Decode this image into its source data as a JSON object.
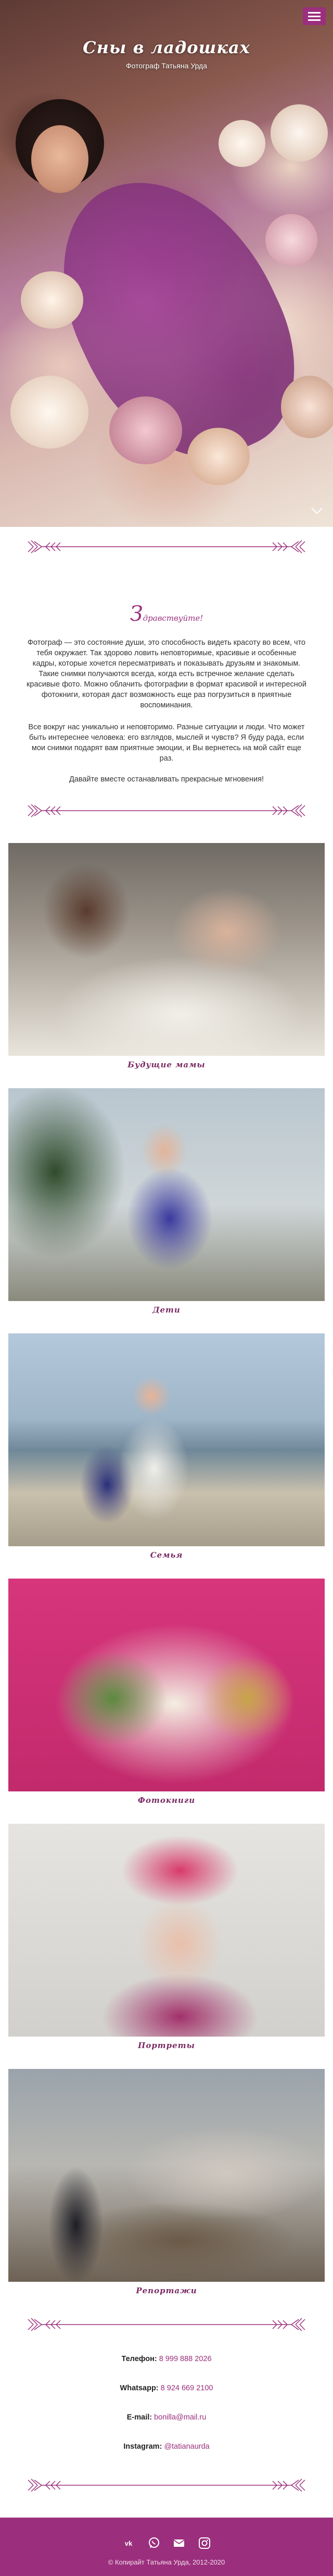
{
  "header": {
    "title": "Сны в ладошках",
    "subtitle": "Фотограф Татьяна Урда",
    "menu_icon": "hamburger-icon",
    "scroll_icon": "chevron-down-icon"
  },
  "intro": {
    "greeting_initial": "З",
    "greeting_rest": "дравствуйте!",
    "paragraph1": "Фотограф — это состояние души, это способность видеть красоту во всем, что тебя окружает. Так здорово ловить неповторимые, красивые и особенные кадры, которые хочется пересматривать и показывать друзьям и знакомым. Такие снимки получаются всегда, когда есть встречное желание сделать красивые фото. Можно облачить фотографии в формат красивой и интересной фотокниги, которая даст возможность еще раз погрузиться в приятные воспоминания.",
    "paragraph2": "Все вокруг нас уникально и неповторимо. Разные ситуации и люди. Что может быть интереснее человека: его взглядов, мыслей и чувств? Я буду рада, если мои снимки подарят вам приятные эмоции, и Вы вернетесь на мой сайт еще раз.",
    "paragraph3": "Давайте вместе останавливать прекрасные мгновения!"
  },
  "gallery": [
    {
      "caption": "Будущие мамы"
    },
    {
      "caption": "Дети"
    },
    {
      "caption": "Семья"
    },
    {
      "caption": "Фотокниги"
    },
    {
      "caption": "Портреты"
    },
    {
      "caption": "Репортажи"
    }
  ],
  "contacts": {
    "phone_label": "Телефон:",
    "phone_value": "8 999 888 2026",
    "whatsapp_label": "Whatsapp:",
    "whatsapp_value": "8 924 669 2100",
    "email_label": "E-mail:",
    "email_value": "bonilla@mail.ru",
    "instagram_label": "Instagram:",
    "instagram_value": "@tatianaurda"
  },
  "footer": {
    "icons": [
      "vk-icon",
      "whatsapp-icon",
      "mail-icon",
      "instagram-icon"
    ],
    "copyright": "© Копирайт Татьяна Урда, 2012-2020"
  },
  "colors": {
    "accent": "#9b2f7d",
    "caption": "#7a2a63",
    "footer_bg": "#9b2f7d"
  }
}
